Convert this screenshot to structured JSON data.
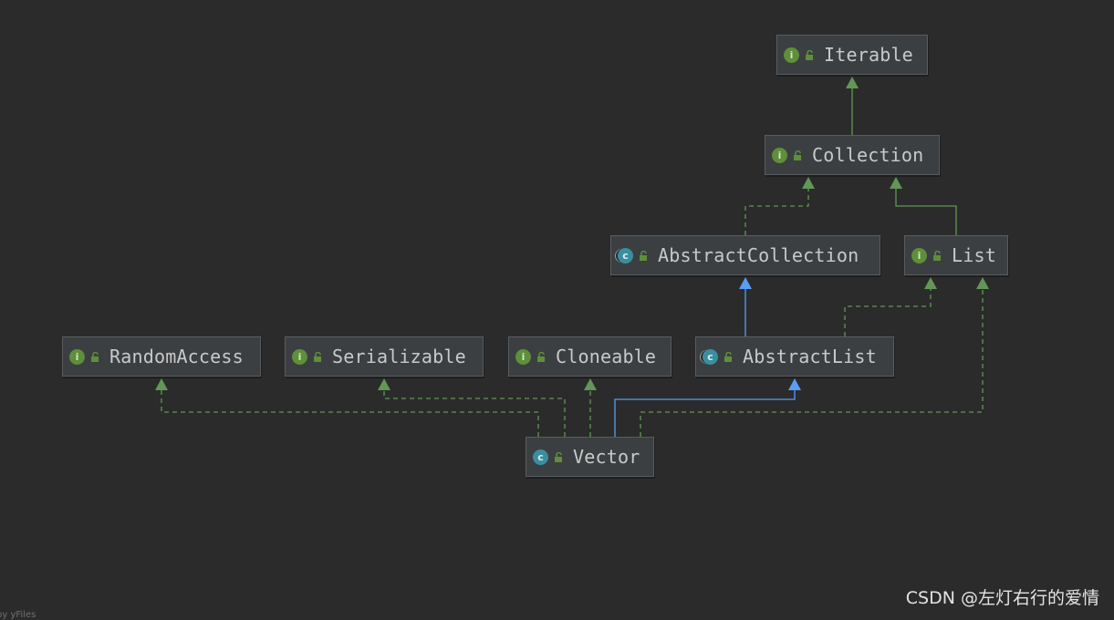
{
  "diagram": {
    "nodes": [
      {
        "id": "iterable",
        "label": "Iterable",
        "kind": "interface",
        "kind_icon": "interface-icon"
      },
      {
        "id": "collection",
        "label": "Collection",
        "kind": "interface",
        "kind_icon": "interface-icon"
      },
      {
        "id": "abstractcollection",
        "label": "AbstractCollection",
        "kind": "abstract-class",
        "kind_icon": "abstract-class-icon"
      },
      {
        "id": "list",
        "label": "List",
        "kind": "interface",
        "kind_icon": "interface-icon"
      },
      {
        "id": "randomaccess",
        "label": "RandomAccess",
        "kind": "interface",
        "kind_icon": "interface-icon"
      },
      {
        "id": "serializable",
        "label": "Serializable",
        "kind": "interface",
        "kind_icon": "interface-icon"
      },
      {
        "id": "cloneable",
        "label": "Cloneable",
        "kind": "interface",
        "kind_icon": "interface-icon"
      },
      {
        "id": "abstractlist",
        "label": "AbstractList",
        "kind": "abstract-class",
        "kind_icon": "abstract-class-icon"
      },
      {
        "id": "vector",
        "label": "Vector",
        "kind": "class",
        "kind_icon": "class-icon"
      }
    ],
    "edges": [
      {
        "from": "collection",
        "to": "iterable",
        "type": "extends"
      },
      {
        "from": "abstractcollection",
        "to": "collection",
        "type": "implements"
      },
      {
        "from": "list",
        "to": "collection",
        "type": "extends"
      },
      {
        "from": "abstractlist",
        "to": "abstractcollection",
        "type": "extends-class"
      },
      {
        "from": "abstractlist",
        "to": "list",
        "type": "implements"
      },
      {
        "from": "vector",
        "to": "randomaccess",
        "type": "implements"
      },
      {
        "from": "vector",
        "to": "serializable",
        "type": "implements"
      },
      {
        "from": "vector",
        "to": "cloneable",
        "type": "implements"
      },
      {
        "from": "vector",
        "to": "abstractlist",
        "type": "extends-class"
      },
      {
        "from": "vector",
        "to": "list",
        "type": "implements"
      }
    ],
    "colors": {
      "interface_edge": "#629755",
      "class_edge": "#589df6",
      "background": "#2b2b2b"
    },
    "access_icon": "unlock-icon"
  },
  "watermark": "CSDN @左灯右行的爱情",
  "corner_text": "by yFiles"
}
